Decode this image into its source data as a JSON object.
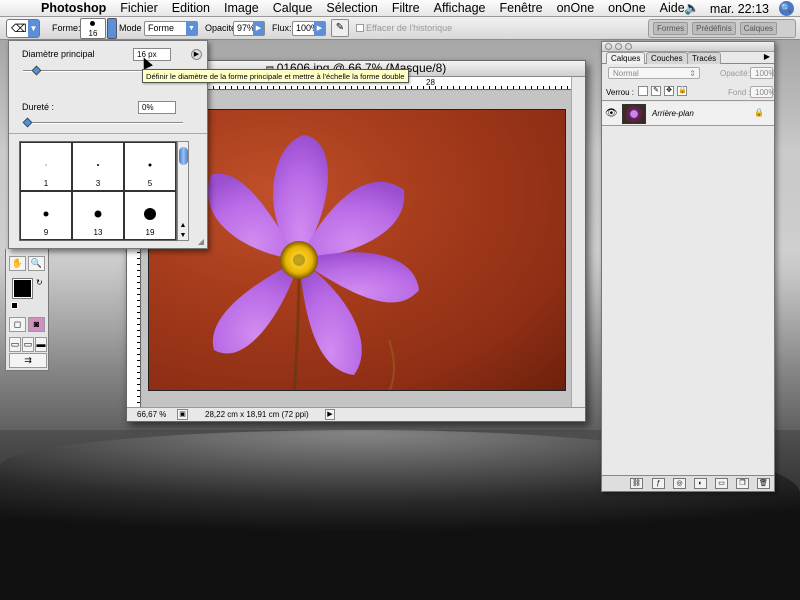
{
  "menubar": {
    "items": [
      "Photoshop",
      "Fichier",
      "Edition",
      "Image",
      "Calque",
      "Sélection",
      "Filtre",
      "Affichage",
      "Fenêtre",
      "onOne",
      "onOne",
      "Aide"
    ],
    "clock": "mar. 22:13",
    "volume_icon": "volume-icon"
  },
  "options": {
    "forme_label": "Forme:",
    "brush_size": "16",
    "mode_label": "Mode :",
    "mode_value": "Forme",
    "opacite_label": "Opacité:",
    "opacite_value": "97%",
    "flux_label": "Flux:",
    "flux_value": "100%",
    "history_label": "Effacer de l'historique",
    "well_tabs": [
      "Formes",
      "Prédéfinis",
      "Calques"
    ]
  },
  "brush_popup": {
    "diameter_label": "Diamètre principal",
    "diameter_value": "16 px",
    "hardness_label": "Dureté :",
    "hardness_value": "0%",
    "diameter_level": 0.08,
    "hardness_level": 0.0,
    "presets": [
      {
        "size": "1",
        "dot": 1
      },
      {
        "size": "3",
        "dot": 2
      },
      {
        "size": "5",
        "dot": 3
      },
      {
        "size": "9",
        "dot": 5
      },
      {
        "size": "13",
        "dot": 7
      },
      {
        "size": "19",
        "dot": 12
      }
    ]
  },
  "tooltip": "Définir le diamètre de la forme principale et mettre à l'échelle la forme double",
  "document": {
    "title": "01606.jpg @ 66,7% (Masque/8)",
    "ruler_labels": [
      "28"
    ],
    "zoom": "66,67 %",
    "dimensions": "28,22 cm x 18,91 cm (72 ppi)"
  },
  "layers": {
    "tabs": [
      "Calques",
      "Couches",
      "Tracés"
    ],
    "blend_mode": "Normal",
    "opacity_label": "Opacité:",
    "opacity_value": "100%",
    "lock_label": "Verrou :",
    "fill_label": "Fond :",
    "fill_value": "100%",
    "layer_name": "Arrière-plan"
  }
}
